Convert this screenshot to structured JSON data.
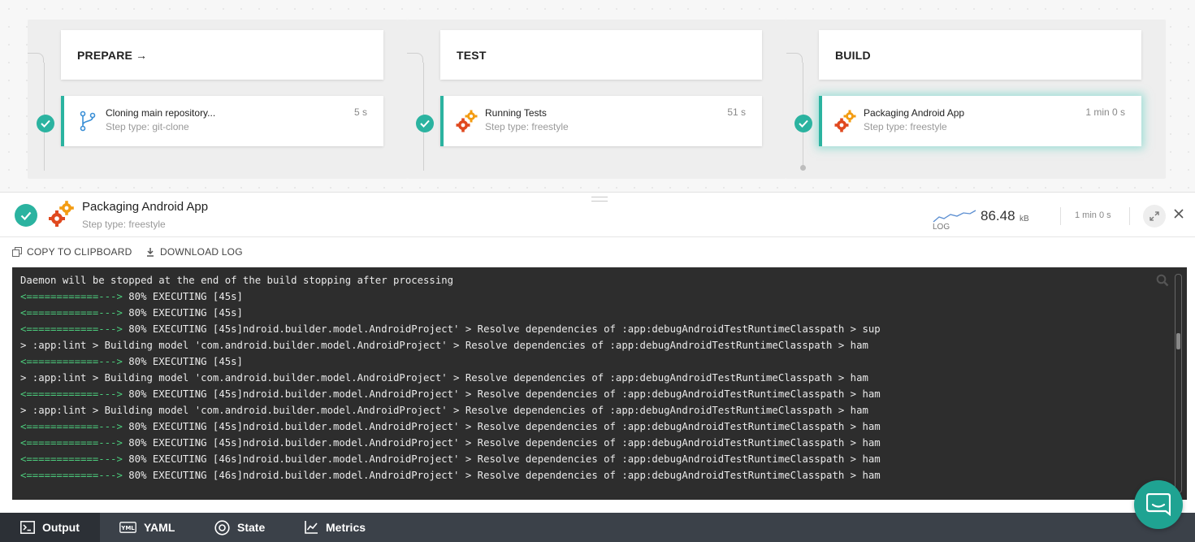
{
  "stages": [
    {
      "name": "PREPARE",
      "has_arrow": true,
      "arrow": "→",
      "step": {
        "title": "Cloning main repository...",
        "type": "Step type: git-clone",
        "duration": "5 s",
        "icon": "git-branch-icon"
      }
    },
    {
      "name": "TEST",
      "has_arrow": false,
      "step": {
        "title": "Running Tests",
        "type": "Step type: freestyle",
        "duration": "51 s",
        "icon": "gears-icon"
      }
    },
    {
      "name": "BUILD",
      "has_arrow": false,
      "step": {
        "title": "Packaging Android App",
        "type": "Step type: freestyle",
        "duration": "1 min 0 s",
        "icon": "gears-icon"
      }
    }
  ],
  "detail": {
    "title": "Packaging Android App",
    "subtitle": "Step type: freestyle",
    "log_label": "LOG",
    "log_size": "86.48",
    "log_unit": "kB",
    "duration": "1 min 0 s"
  },
  "toolbar": {
    "copy_label": "COPY TO CLIPBOARD",
    "download_label": "DOWNLOAD LOG"
  },
  "log": [
    {
      "prefix": "",
      "text": "Daemon will be stopped at the end of the build stopping after processing"
    },
    {
      "prefix": "<============---> ",
      "text": "80% EXECUTING [45s]"
    },
    {
      "prefix": "<============---> ",
      "text": "80% EXECUTING [45s]"
    },
    {
      "prefix": "<============---> ",
      "text": "80% EXECUTING [45s]ndroid.builder.model.AndroidProject' > Resolve dependencies of :app:debugAndroidTestRuntimeClasspath > sup"
    },
    {
      "prefix": "",
      "text": "> :app:lint > Building model 'com.android.builder.model.AndroidProject' > Resolve dependencies of :app:debugAndroidTestRuntimeClasspath > ham"
    },
    {
      "prefix": "<============---> ",
      "text": "80% EXECUTING [45s]"
    },
    {
      "prefix": "",
      "text": "> :app:lint > Building model 'com.android.builder.model.AndroidProject' > Resolve dependencies of :app:debugAndroidTestRuntimeClasspath > ham"
    },
    {
      "prefix": "<============---> ",
      "text": "80% EXECUTING [45s]ndroid.builder.model.AndroidProject' > Resolve dependencies of :app:debugAndroidTestRuntimeClasspath > ham"
    },
    {
      "prefix": "",
      "text": "> :app:lint > Building model 'com.android.builder.model.AndroidProject' > Resolve dependencies of :app:debugAndroidTestRuntimeClasspath > ham"
    },
    {
      "prefix": "<============---> ",
      "text": "80% EXECUTING [45s]ndroid.builder.model.AndroidProject' > Resolve dependencies of :app:debugAndroidTestRuntimeClasspath > ham"
    },
    {
      "prefix": "<============---> ",
      "text": "80% EXECUTING [45s]ndroid.builder.model.AndroidProject' > Resolve dependencies of :app:debugAndroidTestRuntimeClasspath > ham"
    },
    {
      "prefix": "<============---> ",
      "text": "80% EXECUTING [46s]ndroid.builder.model.AndroidProject' > Resolve dependencies of :app:debugAndroidTestRuntimeClasspath > ham"
    },
    {
      "prefix": "<============---> ",
      "text": "80% EXECUTING [46s]ndroid.builder.model.AndroidProject' > Resolve dependencies of :app:debugAndroidTestRuntimeClasspath > ham"
    }
  ],
  "tabs": [
    {
      "label": "Output",
      "icon": "terminal-icon",
      "active": true
    },
    {
      "label": "YAML",
      "icon": "yaml-icon",
      "active": false
    },
    {
      "label": "State",
      "icon": "state-icon",
      "active": false
    },
    {
      "label": "Metrics",
      "icon": "metrics-icon",
      "active": false
    }
  ],
  "colors": {
    "accent": "#2bb3a0",
    "terminal_bg": "#2d2d2d",
    "progress_green": "#4ccd7d",
    "gear_orange": "#f39c12",
    "gear_red": "#e0491f",
    "tabbar_bg": "#3b4149"
  }
}
